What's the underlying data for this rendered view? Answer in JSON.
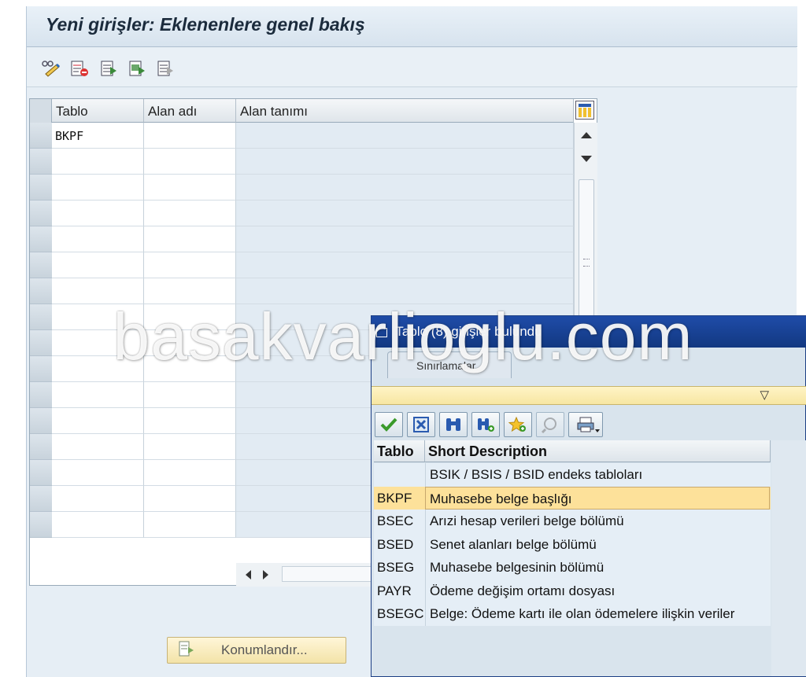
{
  "window": {
    "title": "Yeni girişler: Eklenenlere genel bakış"
  },
  "toolbar": {
    "icons": [
      "display-change-icon",
      "delete-rows-icon",
      "select-all-icon",
      "select-block-icon",
      "deselect-all-icon"
    ]
  },
  "fields_table": {
    "columns": [
      "Tablo",
      "Alan adı",
      "Alan tanımı"
    ],
    "rows": [
      {
        "tablo": "BKPF",
        "alan_adi": "",
        "alan_tanimi": ""
      }
    ]
  },
  "position_button": {
    "label": "Konumlandır..."
  },
  "popup": {
    "title": "Tablo (8)   girişler bulundu",
    "tab": "Sınırlamalar",
    "columns": [
      "Tablo",
      "Short Description"
    ],
    "rows": [
      {
        "tablo": "",
        "desc": "BSIK / BSIS / BSID endeks tabloları"
      },
      {
        "tablo": "BKPF",
        "desc": "Muhasebe belge başlığı"
      },
      {
        "tablo": "BSEC",
        "desc": "Arızi hesap verileri belge bölümü"
      },
      {
        "tablo": "BSED",
        "desc": "Senet alanları belge bölümü"
      },
      {
        "tablo": "BSEG",
        "desc": "Muhasebe belgesinin bölümü"
      },
      {
        "tablo": "PAYR",
        "desc": "Ödeme değişim ortamı dosyası"
      },
      {
        "tablo": "BSEGC",
        "desc": "Belge: Ödeme kartı ile olan ödemelere ilişkin veriler"
      }
    ],
    "selected_row": "BKPF"
  },
  "watermark": "basakvarlioglu.com",
  "colors": {
    "accent": "#1f4ca8",
    "selected": "#fde19a",
    "button": "#f3e3a8"
  }
}
